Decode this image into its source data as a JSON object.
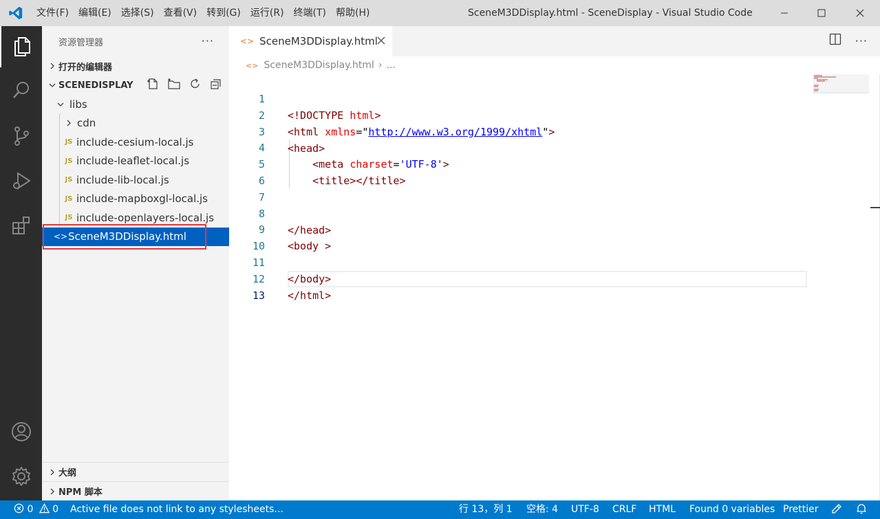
{
  "menubar": [
    "文件(F)",
    "编辑(E)",
    "选择(S)",
    "查看(V)",
    "转到(G)",
    "运行(R)",
    "终端(T)",
    "帮助(H)"
  ],
  "window_title": "SceneM3DDisplay.html - SceneDisplay - Visual Studio Code",
  "sidebar": {
    "title": "资源管理器",
    "open_editors": "打开的编辑器",
    "project": "SCENEDISPLAY",
    "tree": [
      {
        "label": "libs",
        "kind": "folder-open"
      },
      {
        "label": "cdn",
        "kind": "folder"
      },
      {
        "label": "include-cesium-local.js",
        "kind": "js"
      },
      {
        "label": "include-leaflet-local.js",
        "kind": "js"
      },
      {
        "label": "include-lib-local.js",
        "kind": "js"
      },
      {
        "label": "include-mapboxgl-local.js",
        "kind": "js"
      },
      {
        "label": "include-openlayers-local.js",
        "kind": "js"
      },
      {
        "label": "SceneM3DDisplay.html",
        "kind": "html"
      }
    ],
    "js_badge": "JS",
    "outline": "大纲",
    "npm": "NPM 脚本"
  },
  "editor": {
    "tab_label": "SceneM3DDisplay.html",
    "breadcrumb_file": "SceneM3DDisplay.html",
    "breadcrumb_more": "...",
    "line_numbers": [
      "1",
      "2",
      "3",
      "4",
      "5",
      "6",
      "7",
      "8",
      "9",
      "10",
      "11",
      "12",
      "13"
    ],
    "code": {
      "l1_tag": "<!DOCTYPE",
      "l1_attr": "html",
      "l1_end": ">",
      "l2_tag": "<html",
      "l2_attr": "xmlns",
      "l2_eq": "=\"",
      "l2_link": "http://www.w3.org/1999/xhtml",
      "l2_q": "\"",
      "l2_end": ">",
      "l3": "<head>",
      "l4_tag": "<meta",
      "l4_attr": "charset",
      "l4_eq": "=",
      "l4_str": "'UTF-8'",
      "l4_end": ">",
      "l5_open": "<title>",
      "l5_close": "</title>",
      "l8": "</head>",
      "l9": "<body >",
      "l11": "</body>",
      "l12": "</html>"
    }
  },
  "statusbar": {
    "errors": "0",
    "warnings": "0",
    "message": "Active file does not link to any stylesheets...",
    "position": "行 13，列 1",
    "spaces": "空格: 4",
    "encoding": "UTF-8",
    "eol": "CRLF",
    "language": "HTML",
    "variables": "Found 0 variables",
    "formatter": "Prettier"
  },
  "colors": {
    "accent": "#007acc",
    "selection": "#0060c0",
    "activity_bar": "#2c2c2c",
    "highlight_box": "#e03a3a"
  }
}
